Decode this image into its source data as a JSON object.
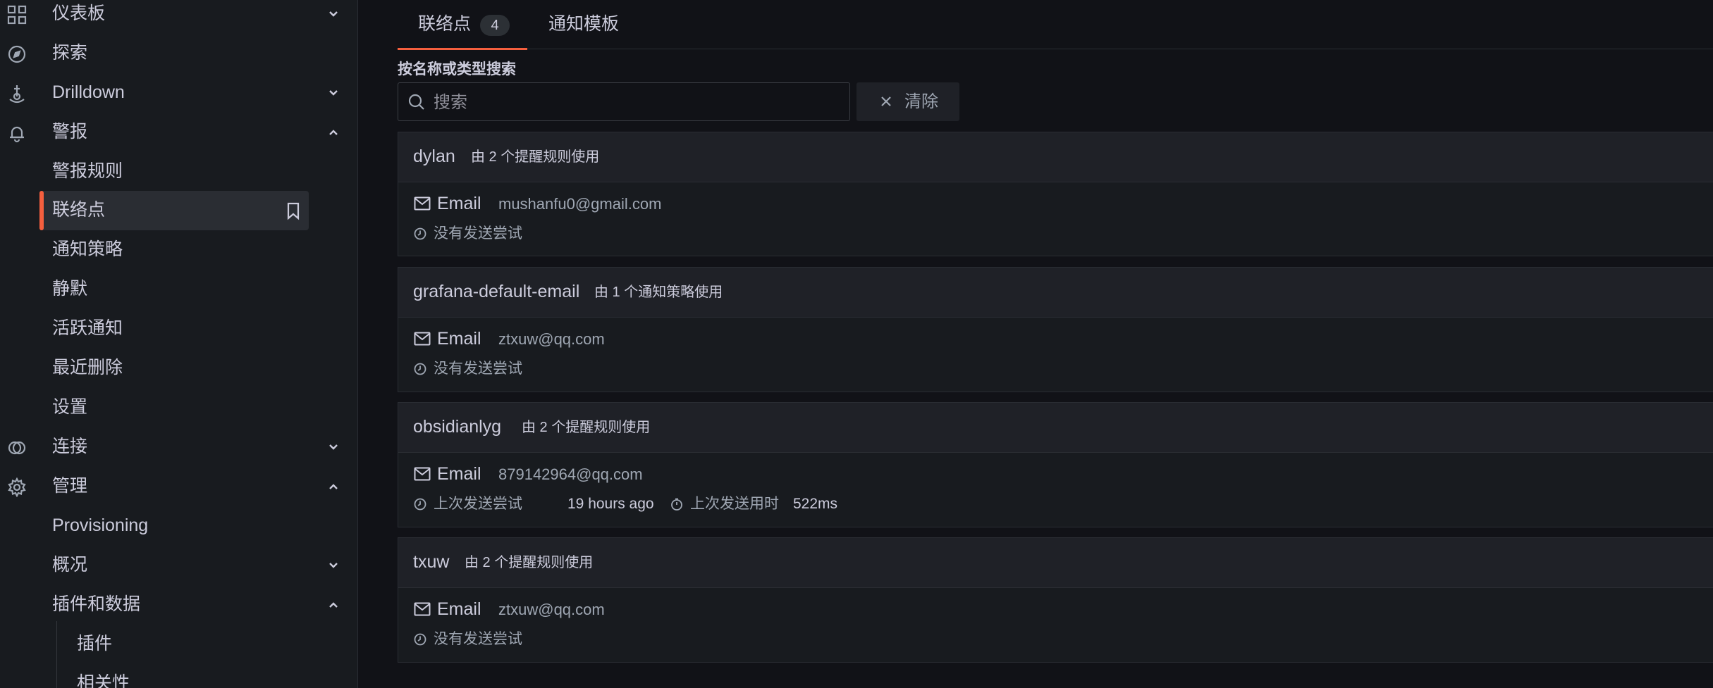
{
  "sidebar": {
    "items": [
      {
        "label": "仪表板",
        "icon": "grid-icon",
        "chevron": "down"
      },
      {
        "label": "探索",
        "icon": "compass-icon"
      },
      {
        "label": "Drilldown",
        "icon": "drilldown-icon",
        "chevron": "down"
      },
      {
        "label": "警报",
        "icon": "bell-icon",
        "chevron": "up"
      },
      {
        "label": "警报规则"
      },
      {
        "label": "联络点",
        "active": true
      },
      {
        "label": "通知策略"
      },
      {
        "label": "静默"
      },
      {
        "label": "活跃通知"
      },
      {
        "label": "最近删除"
      },
      {
        "label": "设置"
      },
      {
        "label": "连接",
        "icon": "link-icon",
        "chevron": "down"
      },
      {
        "label": "管理",
        "icon": "gear-icon",
        "chevron": "up"
      },
      {
        "label": "Provisioning"
      },
      {
        "label": "概况",
        "chevron": "down"
      },
      {
        "label": "插件和数据",
        "chevron": "up"
      },
      {
        "label": "插件"
      },
      {
        "label": "相关性"
      }
    ]
  },
  "tabs": [
    {
      "label": "联络点",
      "count": "4",
      "active": true
    },
    {
      "label": "通知模板"
    }
  ],
  "search": {
    "label": "按名称或类型搜索",
    "placeholder": "搜索",
    "value": "",
    "clear_label": "清除"
  },
  "contact_points": [
    {
      "name": "dylan",
      "usage": "由 2 个提醒规则使用",
      "type": "Email",
      "address": "mushanfu0@gmail.com",
      "status": "没有发送尝试"
    },
    {
      "name": "grafana-default-email",
      "usage": "由 1 个通知策略使用",
      "type": "Email",
      "address": "ztxuw@qq.com",
      "status": "没有发送尝试"
    },
    {
      "name": "obsidianlyg",
      "usage": "由 2 个提醒规则使用",
      "type": "Email",
      "address": "879142964@qq.com",
      "last_attempt_label": "上次发送尝试",
      "last_attempt_value": "19 hours ago",
      "duration_label": "上次发送用时",
      "duration_value": "522ms"
    },
    {
      "name": "txuw",
      "usage": "由 2 个提醒规则使用",
      "type": "Email",
      "address": "ztxuw@qq.com",
      "status": "没有发送尝试"
    }
  ],
  "colors": {
    "accent": "#f55f3e",
    "background": "#111217",
    "panel": "#181b1f",
    "text": "#ccccdc",
    "muted": "#9fa7b3"
  }
}
